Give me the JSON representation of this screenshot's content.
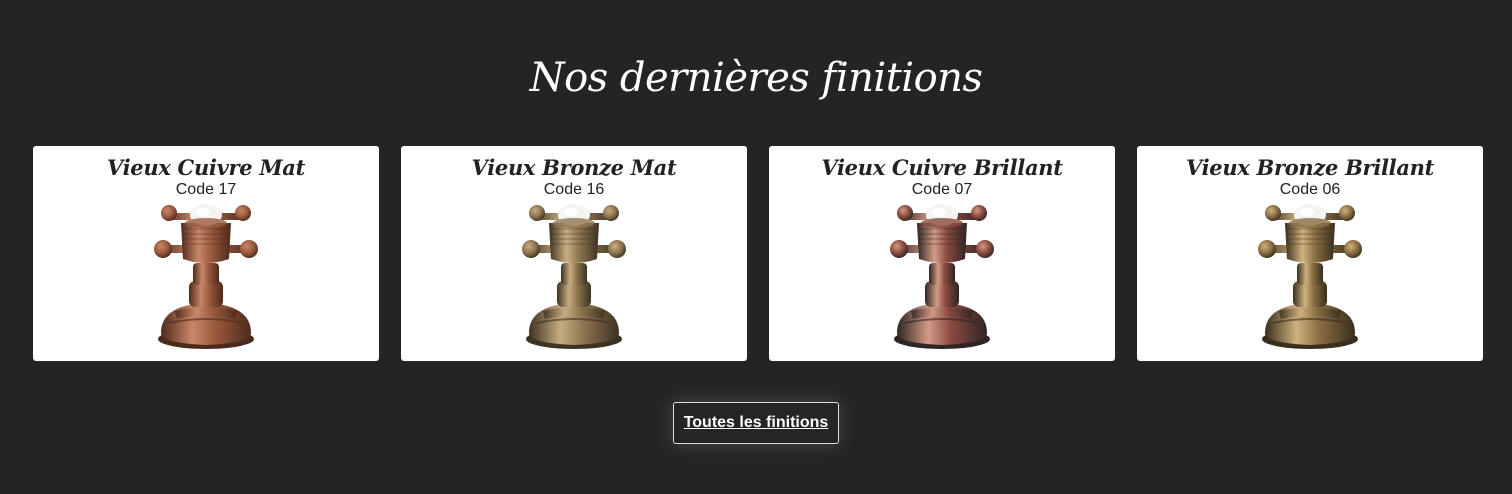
{
  "section": {
    "title": "Nos dernières finitions"
  },
  "finishes": [
    {
      "name": "Vieux Cuivre Mat",
      "code": "Code 17",
      "image": "valve-old-copper-matte",
      "color_light": "#c9876a",
      "color_mid": "#9a5a3e",
      "color_dark": "#4e2a1b"
    },
    {
      "name": "Vieux Bronze Mat",
      "code": "Code 16",
      "image": "valve-old-bronze-matte",
      "color_light": "#c7ad82",
      "color_mid": "#8e7550",
      "color_dark": "#3e3222"
    },
    {
      "name": "Vieux Cuivre Brillant",
      "code": "Code 07",
      "image": "valve-old-copper-glossy",
      "color_light": "#d39b86",
      "color_mid": "#8a4a40",
      "color_dark": "#2f2523"
    },
    {
      "name": "Vieux Bronze Brillant",
      "code": "Code 06",
      "image": "valve-old-bronze-glossy",
      "color_light": "#cfb27e",
      "color_mid": "#8a6f44",
      "color_dark": "#3a2e1d"
    }
  ],
  "cta": {
    "label": "Toutes les finitions"
  }
}
